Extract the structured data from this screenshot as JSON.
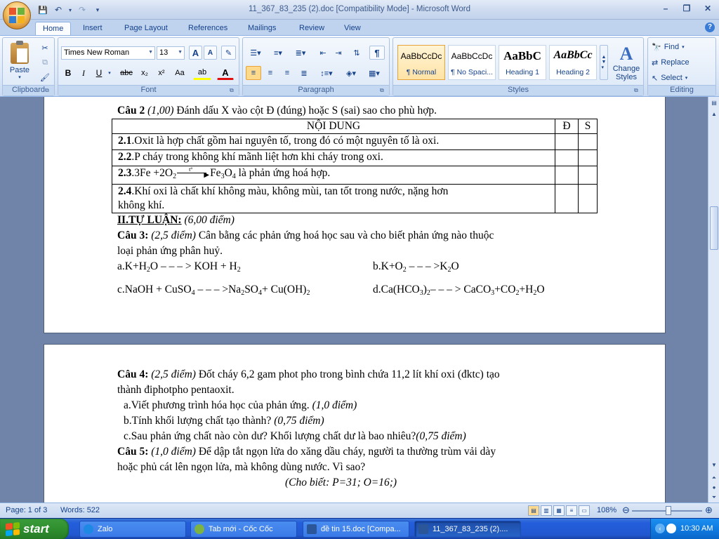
{
  "window": {
    "title": "11_367_83_235 (2).doc [Compatibility Mode] - Microsoft Word",
    "minimize": "–",
    "restore": "❐",
    "close": "✕"
  },
  "qat": {
    "save": "💾",
    "undo": "↶",
    "redo": "↷",
    "more": "▾"
  },
  "tabs": [
    "Home",
    "Insert",
    "Page Layout",
    "References",
    "Mailings",
    "Review",
    "View"
  ],
  "ribbon": {
    "clipboard": {
      "label": "Clipboard",
      "paste": "Paste"
    },
    "font": {
      "label": "Font",
      "name": "Times New Roman",
      "size": "13",
      "grow": "A",
      "shrink": "A",
      "clear": "✎",
      "bold": "B",
      "italic": "I",
      "underline": "U",
      "strike": "abc",
      "sub": "x₂",
      "sup": "x²",
      "case": "Aa",
      "highlight": "ab",
      "color": "A"
    },
    "paragraph": {
      "label": "Paragraph",
      "pilcrow": "¶"
    },
    "styles": {
      "label": "Styles",
      "tiles": [
        {
          "sample": "AaBbCcDc",
          "name": "¶ Normal"
        },
        {
          "sample": "AaBbCcDc",
          "name": "¶ No Spaci..."
        },
        {
          "sample": "AaBbC",
          "name": "Heading 1"
        },
        {
          "sample": "AaBbCc",
          "name": "Heading 2"
        }
      ],
      "change": "Change Styles"
    },
    "editing": {
      "label": "Editing",
      "find": "Find",
      "replace": "Replace",
      "select": "Select"
    }
  },
  "doc": {
    "page1": {
      "cau2_head": "Câu 2",
      "cau2_points": "(1,00)",
      "cau2_text": " Đánh dấu X vào cột Đ (đúng) hoặc S (sai) sao cho phù hợp.",
      "table": {
        "h_content": "NỘI DUNG",
        "h_d": "Đ",
        "h_s": "S",
        "rows": [
          {
            "num": "2.1",
            "text": ".Oxit là hợp chất gồm hai nguyên tố, trong đó có một nguyên tố là oxi."
          },
          {
            "num": "2.2",
            "text": ".P cháy trong không khí mãnh liệt hơn khi cháy trong oxi."
          },
          {
            "num": "2.3",
            "text": ".3Fe +2O",
            "s1": "2",
            "arrow_top": "t°",
            "t2": "Fe",
            "s2": "3",
            "t3": "O",
            "s3": "4",
            "t4": " là phản ứng hoá hợp."
          },
          {
            "num": "2.4",
            "text": ".Khí oxi là chất khí không màu, không mùi, tan tốt trong nước, nặng hơn",
            "text2": "không khí."
          }
        ]
      },
      "part2_head": "II.TỰ LUẬN:",
      "part2_points": " (6,00 điểm)",
      "cau3_head": "Câu 3:",
      "cau3_points": " (2,5 điểm)",
      "cau3_text": " Cân bằng các phản ứng hoá học sau và cho biết phản ứng nào thuộc",
      "cau3_text2": "loại phản ứng phân huỷ.",
      "eq_a": {
        "p1": "a.K+H",
        "s1": "2",
        "p2": "O – – – > KOH + H",
        "s2": "2"
      },
      "eq_b": {
        "p1": "b.K+O",
        "s1": "2",
        "p2": " – – – >K",
        "s2": "2",
        "p3": "O"
      },
      "eq_c": {
        "p1": "c.NaOH + CuSO",
        "s1": "4",
        "p2": " – – – >Na",
        "s2": "2",
        "p3": "SO",
        "s3": "4",
        "p4": "+ Cu(OH)",
        "s4": "2"
      },
      "eq_d": {
        "p1": "d.Ca(HCO",
        "s1": "3",
        "p2": ")",
        "s2": "2",
        "p3": "– – – > CaCO",
        "s3": "3",
        "p4": "+CO",
        "s4": "2",
        "p5": "+H",
        "s5": "2",
        "p6": "O"
      }
    },
    "page2": {
      "cau4_head": "Câu 4:",
      "cau4_points": " (2,5 điểm)",
      "cau4_text": " Đốt cháy 6,2 gam phot pho trong bình chứa 11,2 lít khí oxi (đktc) tạo",
      "cau4_text2": "thành điphotpho pentaoxit.",
      "q_a": "a.Viết phương trình hóa học của phản ứng.",
      "q_a_pts": " (1,0 điểm)",
      "q_b": "b.Tính khối lượng chất tạo thành?",
      "q_b_pts": " (0,75 điểm)",
      "q_c": "c.Sau phản ứng chất nào còn dư? Khối lượng chất dư là bao nhiêu?",
      "q_c_pts": "(0,75 điểm)",
      "cau5_head": "Câu 5:",
      "cau5_points": " (1,0 điểm)",
      "cau5_text": " Để dập tắt ngọn lửa do xăng dầu cháy, người ta thường trùm vải dày",
      "cau5_text2": "hoặc phủ cát lên ngọn lửa, mà không dùng nước. Vì sao?",
      "given": "(Cho biết: P=31; O=16;)"
    }
  },
  "status": {
    "page": "Page: 1 of 3",
    "words": "Words: 522",
    "zoom": "108%"
  },
  "taskbar": {
    "start": "start",
    "items": [
      "Zalo",
      "Tab mới - Cốc Cốc",
      "đề tin 15.doc [Compa...",
      "11_367_83_235 (2)...."
    ],
    "clock": "10:30 AM"
  }
}
